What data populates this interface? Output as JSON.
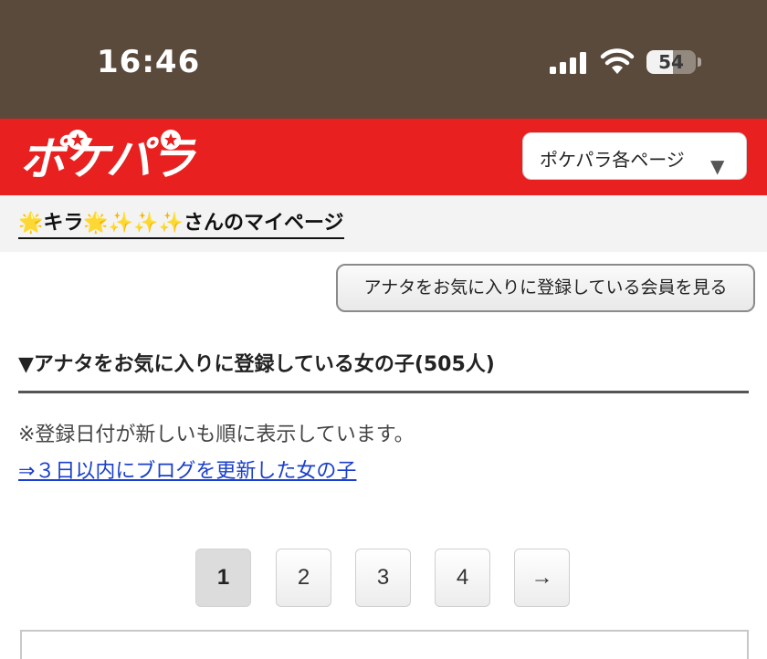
{
  "status_bar": {
    "time": "16:46",
    "battery_level": "54",
    "battery_fraction": 0.54
  },
  "header": {
    "logo_text": "ポケパラ",
    "brand_color": "#e82020",
    "page_menu_label": "ポケパラ各ページ",
    "page_menu_arrow": "▼"
  },
  "mypage": {
    "title": "🌟キラ🌟✨✨✨さんのマイページ"
  },
  "main": {
    "fav_members_button": "アナタをお気に入りに登録している会員を見る",
    "section_heading": "▼アナタをお気に入りに登録している女の子(505人)",
    "sort_note": "※登録日付が新しいも順に表示しています。",
    "blog_link": "⇒３日以内にブログを更新した女の子",
    "link_color": "#1a3fcc"
  },
  "pagination": {
    "pages": [
      "1",
      "2",
      "3",
      "4"
    ],
    "current_page": "1",
    "next_label": "→"
  },
  "icons": [
    "cellular-signal-icon",
    "wifi-icon",
    "battery-icon",
    "chevron-down-icon"
  ]
}
